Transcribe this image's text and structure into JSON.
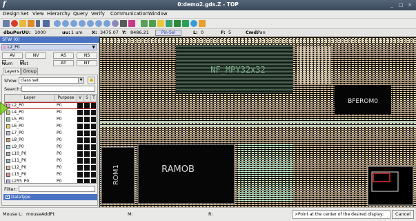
{
  "window": {
    "app_icon": "f",
    "title": "0:demo2.gds.Z - TOP",
    "controls": [
      "_",
      "□",
      "×"
    ]
  },
  "menu": [
    "Design",
    "Set",
    "View",
    "Hierarchy",
    "Query",
    "Verify",
    "Communication",
    "Window"
  ],
  "toolbar": {
    "icons": [
      "open-icon",
      "close-icon",
      "folder-icon",
      "cell-icon",
      "pause-icon",
      "hierarchy-icon",
      "zoom-in-icon",
      "zoom-out-icon",
      "zoom-fit-icon",
      "zoom-box-icon",
      "pan-icon",
      "ruler-icon",
      "refresh-icon",
      "undo-icon",
      "draw-icon",
      "edit-icon",
      "star-icon",
      "flag-icon",
      "group-icon",
      "layer-icon",
      "chart-icon",
      "check-icon",
      "globe-icon",
      "cube-icon"
    ]
  },
  "coords": {
    "dbu_label": "dbuPerUU:",
    "dbu_value": "1000",
    "uu_label": "uu:",
    "uu_value": "1 um",
    "x_label": "X:",
    "x_value": "3475.07",
    "y_label": "Y:",
    "y_value": "8486.21",
    "mode_box": "Pin-Sel",
    "l_label": "L:",
    "l_value": "0",
    "f_label": "F:",
    "f_value": "5",
    "cmd_label": "Cmd:",
    "cmd_value": "Pan"
  },
  "panel": {
    "header": "SFW (0)",
    "current_layer": "L2_P0",
    "buttons_row1": [
      "AV",
      "NV",
      "AS",
      "NS"
    ],
    "num_label": "Num",
    "inst_label": "Inst",
    "buttons_row2": [
      "AT",
      "NT"
    ],
    "tabs": [
      "Layers",
      "Group"
    ],
    "show_label": "Show:",
    "show_value": "class set",
    "search_label": "Search:",
    "filter_label": "Filter:",
    "datatype_label": "DataType",
    "table_headers": [
      "Layer",
      "Purpose",
      "V",
      "S",
      "T"
    ],
    "layers": [
      {
        "name": "L2_P0",
        "purpose": "P0",
        "color": "#e8a0c8"
      },
      {
        "name": "L4_P0",
        "purpose": "P0",
        "color": "#b8c870"
      },
      {
        "name": "L5_P0",
        "purpose": "P0",
        "color": "#80c8a0"
      },
      {
        "name": "L6_P0",
        "purpose": "P0",
        "color": "#f0d060"
      },
      {
        "name": "L7_P0",
        "purpose": "P0",
        "color": "#c8b0e0"
      },
      {
        "name": "L8_P0",
        "purpose": "P0",
        "color": "#d0a070"
      },
      {
        "name": "L9_P0",
        "purpose": "P0",
        "color": "#a0d0e8"
      },
      {
        "name": "L10_P0",
        "purpose": "P0",
        "color": "#b0b0b0"
      },
      {
        "name": "L11_P0",
        "purpose": "P0",
        "color": "#90c0c0"
      },
      {
        "name": "L12_P0",
        "purpose": "P0",
        "color": "#e0c090"
      },
      {
        "name": "L15_P0",
        "purpose": "P0",
        "color": "#d89090"
      },
      {
        "name": "L255_P0",
        "purpose": "P0",
        "color": "#c0a8e8"
      }
    ]
  },
  "canvas": {
    "labels": [
      "NF_MPY32x32",
      "BFEROM0",
      "RAMOB",
      "ROM1"
    ]
  },
  "status": {
    "mouse_label": "Mouse L:",
    "mouse_value": "mouseAddPt",
    "m_label": "M:",
    "r_label": "R:",
    "prompt": ">Point at the center of the desired display:",
    "cancel": "Cancel"
  },
  "colors": {
    "selection_blue": "#4a73c4",
    "titlebar": "#4b5a6e",
    "canvas_bg": "#000000"
  }
}
